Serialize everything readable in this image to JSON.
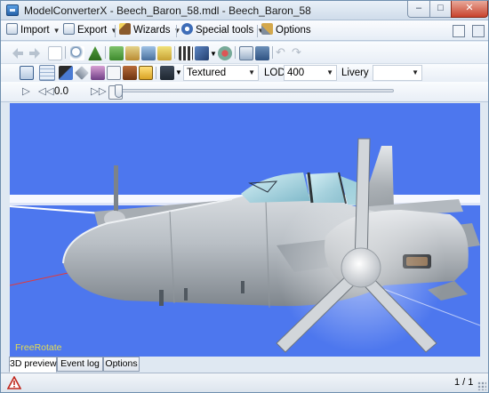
{
  "window": {
    "title": "ModelConverterX - Beech_Baron_58.mdl - Beech_Baron_58",
    "controls": {
      "minimize": "–",
      "maximize": "□",
      "close": "✕"
    }
  },
  "menu": {
    "import": "Import",
    "export": "Export",
    "wizards": "Wizards",
    "special_tools": "Special tools",
    "options": "Options"
  },
  "toolbar2": {
    "render_mode": "Textured",
    "lod_label": "LOD",
    "lod_value": "400",
    "livery_label": "Livery",
    "livery_value": ""
  },
  "toolbar3": {
    "animation_time": "0.0",
    "timeline_position": 0.0
  },
  "viewport": {
    "mode_label": "FreeRotate",
    "background_color": "#4d77ee"
  },
  "tabs": [
    "3D preview",
    "Event log",
    "Options"
  ],
  "status": {
    "count": "1 / 1"
  },
  "icons": {
    "back": "arrow-left-icon",
    "forward": "arrow-right-icon",
    "warning": "warning-triangle-icon"
  }
}
